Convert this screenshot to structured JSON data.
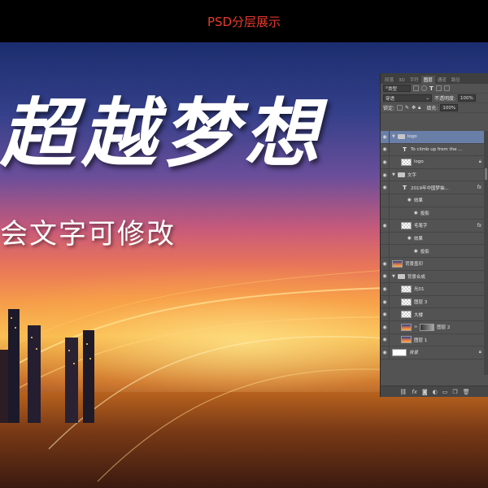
{
  "header": {
    "title": "PSD分层展示"
  },
  "poster": {
    "slogan": "超越梦想",
    "subtitle": "会文字可修改"
  },
  "layers_panel": {
    "tabs": [
      "段落",
      "3D",
      "字符",
      "图层",
      "通道",
      "路径"
    ],
    "active_tab": "图层",
    "filter_label": "类型",
    "blend_mode": "穿透",
    "opacity_label": "不透明度:",
    "opacity_value": "100%",
    "lock_label": "锁定:",
    "fill_label": "填充:",
    "fill_value": "100%",
    "layers": [
      {
        "name": "logo",
        "kind": "group",
        "selected": true
      },
      {
        "name": "To climb up from the ...",
        "kind": "text"
      },
      {
        "name": "logo",
        "kind": "image"
      },
      {
        "name": "文字",
        "kind": "group"
      },
      {
        "name": "2019年中国梦抽...",
        "kind": "text",
        "fx": "fx"
      },
      {
        "name": "效果",
        "kind": "effect"
      },
      {
        "name": "投影",
        "kind": "effect-item"
      },
      {
        "name": "毛笔字",
        "kind": "image",
        "fx": "fx"
      },
      {
        "name": "效果",
        "kind": "effect"
      },
      {
        "name": "投影",
        "kind": "effect-item"
      },
      {
        "name": "背景盖印",
        "kind": "image"
      },
      {
        "name": "背景合成",
        "kind": "group"
      },
      {
        "name": "光01",
        "kind": "image"
      },
      {
        "name": "图层 3",
        "kind": "image"
      },
      {
        "name": "大楼",
        "kind": "image"
      },
      {
        "name": "图层 2",
        "kind": "masked"
      },
      {
        "name": "图层 1",
        "kind": "image"
      },
      {
        "name": "背景",
        "kind": "background"
      }
    ],
    "footer_icons": [
      "link-icon",
      "fx-icon",
      "mask-icon",
      "adjustment-icon",
      "folder-icon",
      "new-layer-icon",
      "trash-icon"
    ]
  }
}
